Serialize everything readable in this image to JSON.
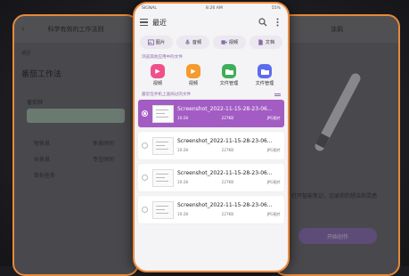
{
  "left_phone": {
    "title": "科学有效的工作法则",
    "back_label": "返回",
    "heading": "番茄工作法",
    "items": [
      "番茄钟",
      "短休息",
      "长休息",
      "目标任务",
      "休息时间",
      "专注时间"
    ]
  },
  "right_phone": {
    "title": "涂鸦",
    "desc": "打开智能笔记，记录你的想法和灵感",
    "button": "开始创作"
  },
  "status": {
    "left": "SIGNAL",
    "time": "8:26 AM",
    "battery": "55%"
  },
  "appbar": {
    "title": "最近"
  },
  "chips": [
    {
      "label": "图片",
      "icon": "image-icon"
    },
    {
      "label": "音频",
      "icon": "mic-icon"
    },
    {
      "label": "视频",
      "icon": "video-icon"
    },
    {
      "label": "文档",
      "icon": "doc-icon"
    }
  ],
  "apps_section": "浏览其他应用中的文件",
  "apps": [
    {
      "label": "视频",
      "color": "#f0508a",
      "glyph": "▶"
    },
    {
      "label": "视频",
      "color": "#f59a2c",
      "glyph": "▶"
    },
    {
      "label": "文件管理",
      "color": "#3fae5a",
      "glyph": "■"
    },
    {
      "label": "文件管理",
      "color": "#5b6cf0",
      "glyph": "■"
    }
  ],
  "recent_section": "最近在手机上查阅过的文件",
  "files": [
    {
      "name": "Screenshot_2022-11-15-28-23-06...",
      "date": "10:28",
      "size": "227KB",
      "type": "JPG图片",
      "selected": true
    },
    {
      "name": "Screenshot_2022-11-15-28-23-06...",
      "date": "10:28",
      "size": "227KB",
      "type": "JPG图片",
      "selected": false
    },
    {
      "name": "Screenshot_2022-11-15-28-23-06...",
      "date": "10:28",
      "size": "227KB",
      "type": "JPG图片",
      "selected": false
    },
    {
      "name": "Screenshot_2022-11-15-28-23-06...",
      "date": "10:28",
      "size": "227KB",
      "type": "JPG图片",
      "selected": false
    }
  ]
}
